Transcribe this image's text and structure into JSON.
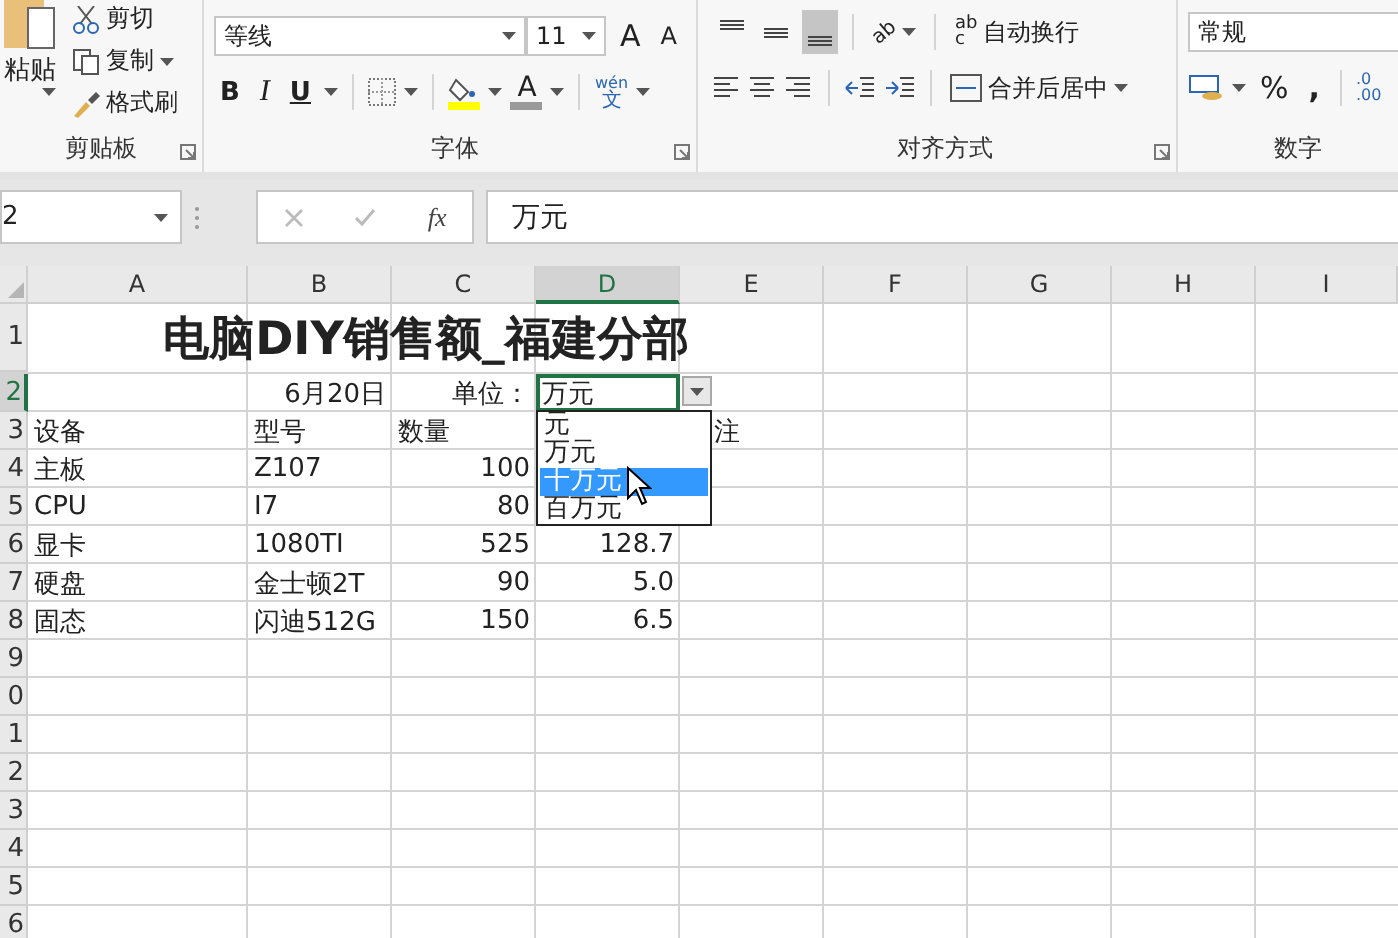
{
  "ribbon": {
    "clipboard": {
      "paste": "粘贴",
      "cut": "剪切",
      "copy": "复制",
      "format_painter": "格式刷",
      "label": "剪贴板"
    },
    "font": {
      "font_name": "等线",
      "font_size": "11",
      "grow": "A",
      "shrink": "A",
      "bold": "B",
      "italic": "I",
      "underline": "U",
      "font_color": "A",
      "phonetic": [
        "wén",
        "文"
      ],
      "label": "字体"
    },
    "alignment": {
      "vertical": [
        {
          "selected": false
        },
        {
          "selected": false
        },
        {
          "selected": true
        }
      ],
      "orientation": "ab",
      "wrap_glyph": [
        "ab",
        "c"
      ],
      "wrap_text": "自动换行",
      "merge": "合并后居中",
      "label": "对齐方式"
    },
    "number": {
      "format": "常规",
      "percent": "%",
      "comma": ",",
      "decimals": [
        ".0",
        ".00"
      ],
      "label": "数字"
    }
  },
  "formula_bar": {
    "name_box": "2",
    "fx": "fx",
    "value": "万元"
  },
  "sheet": {
    "columns": [
      {
        "label": "A",
        "selected": false
      },
      {
        "label": "B",
        "selected": false
      },
      {
        "label": "C",
        "selected": false
      },
      {
        "label": "D",
        "selected": true
      },
      {
        "label": "E",
        "selected": false
      },
      {
        "label": "F",
        "selected": false
      },
      {
        "label": "G",
        "selected": false
      },
      {
        "label": "H",
        "selected": false
      },
      {
        "label": "I",
        "selected": false
      }
    ],
    "rows": [
      {
        "header": "1",
        "selected": false,
        "cells": {
          "A": {
            "text": "电脑DIY销售额_福建分部",
            "kind": "title",
            "selected": false
          }
        }
      },
      {
        "header": "2",
        "selected": true,
        "cells": {
          "B": {
            "text": "6月20日",
            "kind": "date",
            "selected": false
          },
          "C": {
            "text": "单位：",
            "kind": "label",
            "selected": false
          },
          "D": {
            "text": "万元",
            "kind": "validation",
            "selected": true
          }
        }
      },
      {
        "header": "3",
        "selected": false,
        "cells": {
          "A": {
            "text": "设备",
            "kind": "text",
            "selected": false
          },
          "B": {
            "text": "型号",
            "kind": "text",
            "selected": false
          },
          "C": {
            "text": "数量",
            "kind": "text",
            "selected": false
          },
          "E": {
            "text": "注",
            "kind": "partly_covered",
            "selected": false
          }
        }
      },
      {
        "header": "4",
        "selected": false,
        "cells": {
          "A": {
            "text": "主板",
            "kind": "text",
            "selected": false
          },
          "B": {
            "text": "Z107",
            "kind": "text",
            "selected": false
          },
          "C": {
            "text": "100",
            "kind": "number",
            "selected": false
          }
        }
      },
      {
        "header": "5",
        "selected": false,
        "cells": {
          "A": {
            "text": "CPU",
            "kind": "text",
            "selected": false
          },
          "B": {
            "text": "I7",
            "kind": "text",
            "selected": false
          },
          "C": {
            "text": "80",
            "kind": "number",
            "selected": false
          }
        }
      },
      {
        "header": "6",
        "selected": false,
        "cells": {
          "A": {
            "text": "显卡",
            "kind": "text",
            "selected": false
          },
          "B": {
            "text": "1080TI",
            "kind": "text",
            "selected": false
          },
          "C": {
            "text": "525",
            "kind": "number",
            "selected": false
          },
          "D": {
            "text": "128.7",
            "kind": "number",
            "selected": false
          }
        }
      },
      {
        "header": "7",
        "selected": false,
        "cells": {
          "A": {
            "text": "硬盘",
            "kind": "text",
            "selected": false
          },
          "B": {
            "text": "金士顿2T",
            "kind": "text",
            "selected": false
          },
          "C": {
            "text": "90",
            "kind": "number",
            "selected": false
          },
          "D": {
            "text": "5.0",
            "kind": "number",
            "selected": false
          }
        }
      },
      {
        "header": "8",
        "selected": false,
        "cells": {
          "A": {
            "text": "固态",
            "kind": "text",
            "selected": false
          },
          "B": {
            "text": "闪迪512G",
            "kind": "text",
            "selected": false
          },
          "C": {
            "text": "150",
            "kind": "number",
            "selected": false
          },
          "D": {
            "text": "6.5",
            "kind": "number",
            "selected": false
          }
        }
      },
      {
        "header": "9",
        "selected": false,
        "cells": {}
      },
      {
        "header": "0",
        "selected": false,
        "cells": {}
      },
      {
        "header": "1",
        "selected": false,
        "cells": {}
      },
      {
        "header": "2",
        "selected": false,
        "cells": {}
      },
      {
        "header": "3",
        "selected": false,
        "cells": {}
      },
      {
        "header": "4",
        "selected": false,
        "cells": {}
      },
      {
        "header": "5",
        "selected": false,
        "cells": {}
      },
      {
        "header": "6",
        "selected": false,
        "cells": {}
      }
    ],
    "dropdown": {
      "items": [
        {
          "text": "元",
          "selected": false
        },
        {
          "text": "万元",
          "selected": false
        },
        {
          "text": "十万元",
          "selected": true
        },
        {
          "text": "百万元",
          "selected": false
        }
      ]
    }
  }
}
